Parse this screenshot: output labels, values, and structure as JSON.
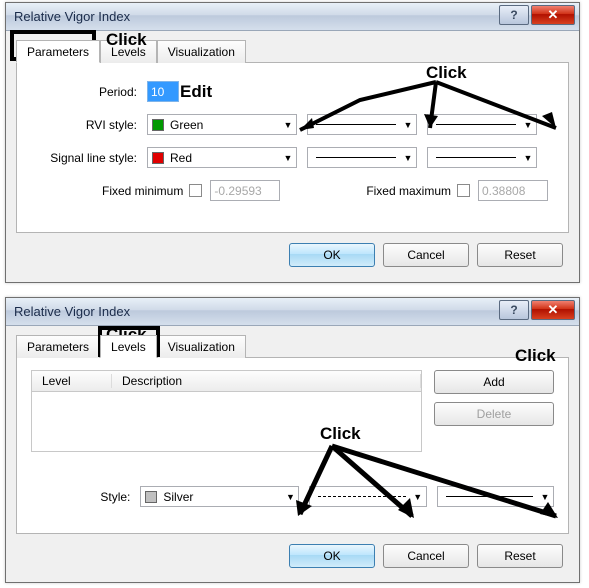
{
  "dialog1": {
    "title": "Relative Vigor Index",
    "tabs": {
      "parameters": "Parameters",
      "levels": "Levels",
      "visualization": "Visualization"
    },
    "period_label": "Period:",
    "period_value": "10",
    "rvi_label": "RVI style:",
    "rvi_color_name": "Green",
    "rvi_color_hex": "#009900",
    "signal_label": "Signal line style:",
    "signal_color_name": "Red",
    "signal_color_hex": "#e00000",
    "fixed_min_label": "Fixed minimum",
    "fixed_min_value": "-0.29593",
    "fixed_max_label": "Fixed maximum",
    "fixed_max_value": "0.38808",
    "ok": "OK",
    "cancel": "Cancel",
    "reset": "Reset"
  },
  "dialog2": {
    "title": "Relative Vigor Index",
    "tabs": {
      "parameters": "Parameters",
      "levels": "Levels",
      "visualization": "Visualization"
    },
    "col_level": "Level",
    "col_desc": "Description",
    "add": "Add",
    "delete": "Delete",
    "style_label": "Style:",
    "style_color_name": "Silver",
    "style_color_hex": "#c0c0c0",
    "ok": "OK",
    "cancel": "Cancel",
    "reset": "Reset"
  },
  "annotations": {
    "click": "Click",
    "edit": "Edit"
  }
}
